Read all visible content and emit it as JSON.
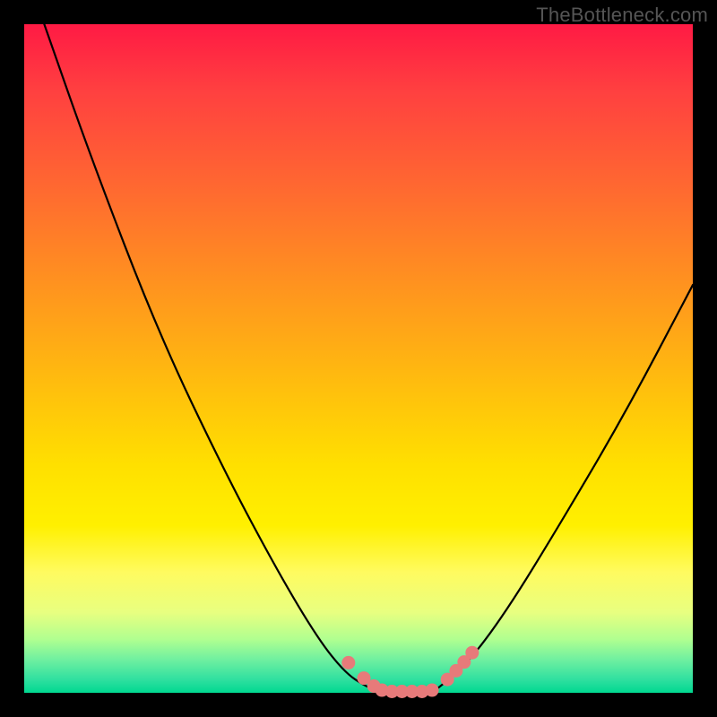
{
  "watermark": "TheBottleneck.com",
  "chart_data": {
    "type": "line",
    "title": "",
    "xlabel": "",
    "ylabel": "",
    "xlim": [
      0,
      100
    ],
    "ylim": [
      0,
      100
    ],
    "series": [
      {
        "name": "left-curve",
        "x": [
          3,
          10,
          20,
          30,
          38,
          44,
          48,
          51,
          53.5
        ],
        "y": [
          100,
          80,
          54,
          33,
          18,
          8,
          3,
          1,
          0
        ]
      },
      {
        "name": "floor",
        "x": [
          53.5,
          61
        ],
        "y": [
          0,
          0
        ]
      },
      {
        "name": "right-curve",
        "x": [
          61,
          66,
          72,
          80,
          90,
          100
        ],
        "y": [
          0,
          4,
          12,
          25,
          42,
          61
        ]
      }
    ],
    "markers": {
      "color": "#e77a7a",
      "points_xy": [
        [
          48.5,
          4.5
        ],
        [
          50.8,
          2.2
        ],
        [
          52.3,
          1.0
        ],
        [
          53.5,
          0.4
        ],
        [
          55.0,
          0.2
        ],
        [
          56.5,
          0.2
        ],
        [
          58.0,
          0.2
        ],
        [
          59.5,
          0.2
        ],
        [
          61.0,
          0.4
        ],
        [
          63.3,
          2.0
        ],
        [
          64.6,
          3.3
        ],
        [
          65.8,
          4.6
        ],
        [
          67.0,
          6.0
        ]
      ]
    },
    "background_gradient": {
      "top": "#ff1a44",
      "mid": "#ffe000",
      "bottom": "#00d890"
    }
  }
}
